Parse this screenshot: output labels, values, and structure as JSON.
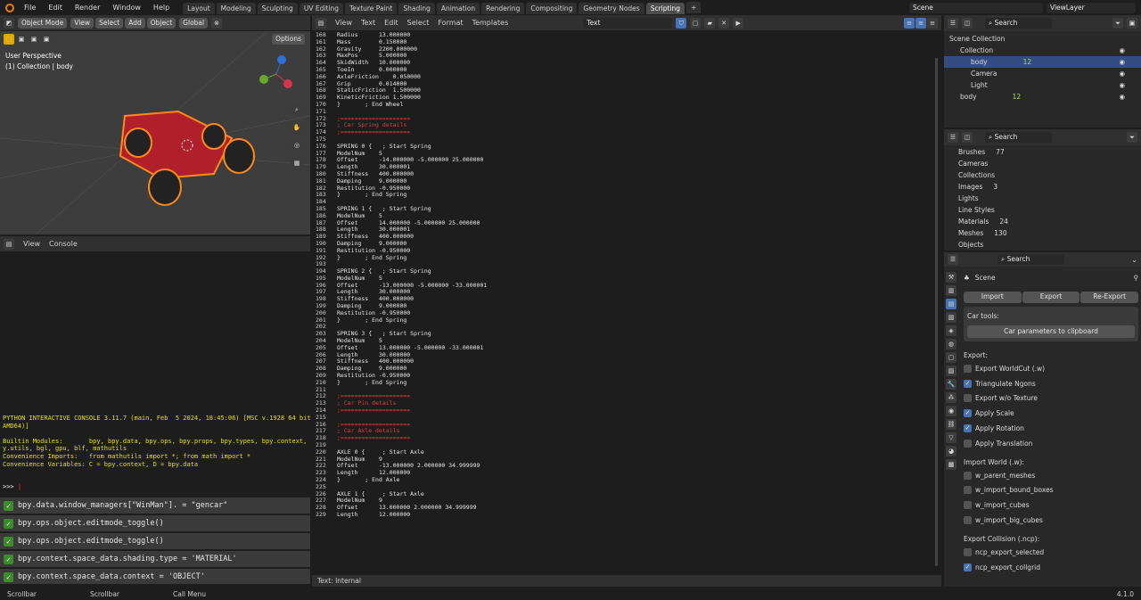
{
  "topbar": {
    "menus": [
      "File",
      "Edit",
      "Render",
      "Window",
      "Help"
    ],
    "tabs": [
      "Layout",
      "Modeling",
      "Sculpting",
      "UV Editing",
      "Texture Paint",
      "Shading",
      "Animation",
      "Rendering",
      "Compositing",
      "Geometry Nodes",
      "Scripting"
    ],
    "active_tab": "Scripting",
    "scene": "Scene",
    "view_layer": "ViewLayer"
  },
  "viewport": {
    "mode": "Object Mode",
    "menus": [
      "View",
      "Select",
      "Add",
      "Object"
    ],
    "transform": "Global",
    "options": "Options",
    "persp": "User Perspective",
    "collection": "(1) Collection | body"
  },
  "console_hdr": {
    "menus": [
      "View",
      "Console"
    ]
  },
  "console": {
    "banner": [
      "PYTHON INTERACTIVE CONSOLE 3.11.7 (main, Feb  5 2024, 18:45:06) [MSC v.1928 64 bit (",
      "AMD64)]",
      "",
      "Builtin Modules:       bpy, bpy.data, bpy.ops, bpy.props, bpy.types, bpy.context, bp",
      "y.utils, bgl, gpu, blf, mathutils",
      "Convenience Imports:   from mathutils import *; from math import *",
      "Convenience Variables: C = bpy.context, D = bpy.data"
    ],
    "prompt": ">>> ",
    "history": [
      "bpy.data.window_managers[\"WinMan\"]. = \"gencar\"",
      "bpy.ops.object.editmode_toggle()",
      "bpy.ops.object.editmode_toggle()",
      "bpy.context.space_data.shading.type = 'MATERIAL'",
      "bpy.context.space_data.context = 'OBJECT'"
    ]
  },
  "text_hdr": {
    "menus": [
      "View",
      "Text",
      "Edit",
      "Select",
      "Format",
      "Templates"
    ],
    "name": "Text"
  },
  "text_footer": "Text: Internal",
  "code": [
    [
      "168",
      "Radius      13.000000"
    ],
    [
      "161",
      "Mass        0.150000"
    ],
    [
      "162",
      "Gravity     2200.000000"
    ],
    [
      "163",
      "MaxPos      5.000000"
    ],
    [
      "164",
      "SkidWidth   10.000000"
    ],
    [
      "165",
      "ToeIn       0.000000"
    ],
    [
      "166",
      "AxleFriction    0.050000"
    ],
    [
      "167",
      "Grip        0.014000"
    ],
    [
      "168",
      "StaticFriction  1.500000"
    ],
    [
      "169",
      "KineticFriction 1.500000"
    ],
    [
      "170",
      "}       ; End Wheel"
    ],
    [
      "171",
      ""
    ],
    [
      "172",
      ";===================="
    ],
    [
      "173",
      "; Car Spring details"
    ],
    [
      "174",
      ";===================="
    ],
    [
      "175",
      ""
    ],
    [
      "176",
      "SPRING 0 {   ; Start Spring"
    ],
    [
      "177",
      "ModelNum    5"
    ],
    [
      "178",
      "Offset      -14.000000 -5.000000 25.000000"
    ],
    [
      "179",
      "Length      30.000001"
    ],
    [
      "180",
      "Stiffness   400.000000"
    ],
    [
      "181",
      "Damping     9.000000"
    ],
    [
      "182",
      "Restitution -0.950000"
    ],
    [
      "183",
      "}       ; End Spring"
    ],
    [
      "184",
      ""
    ],
    [
      "185",
      "SPRING 1 {   ; Start Spring"
    ],
    [
      "186",
      "ModelNum    5"
    ],
    [
      "187",
      "Offset      14.000000 -5.000000 25.000000"
    ],
    [
      "188",
      "Length      30.000001"
    ],
    [
      "189",
      "Stiffness   400.000000"
    ],
    [
      "190",
      "Damping     9.000000"
    ],
    [
      "191",
      "Restitution -0.950000"
    ],
    [
      "192",
      "}       ; End Spring"
    ],
    [
      "193",
      ""
    ],
    [
      "194",
      "SPRING 2 {   ; Start Spring"
    ],
    [
      "195",
      "ModelNum    5"
    ],
    [
      "196",
      "Offset      -13.000000 -5.000000 -33.000001"
    ],
    [
      "197",
      "Length      30.000000"
    ],
    [
      "198",
      "Stiffness   400.000000"
    ],
    [
      "199",
      "Damping     9.000000"
    ],
    [
      "200",
      "Restitution -0.950000"
    ],
    [
      "201",
      "}       ; End Spring"
    ],
    [
      "202",
      ""
    ],
    [
      "203",
      "SPRING 3 {   ; Start Spring"
    ],
    [
      "204",
      "ModelNum    5"
    ],
    [
      "205",
      "Offset      13.000000 -5.000000 -33.000001"
    ],
    [
      "206",
      "Length      30.000000"
    ],
    [
      "207",
      "Stiffness   400.000000"
    ],
    [
      "208",
      "Damping     9.000000"
    ],
    [
      "209",
      "Restitution -0.950000"
    ],
    [
      "210",
      "}       ; End Spring"
    ],
    [
      "211",
      ""
    ],
    [
      "212",
      ";===================="
    ],
    [
      "213",
      "; Car Pin details"
    ],
    [
      "214",
      ";===================="
    ],
    [
      "215",
      ""
    ],
    [
      "216",
      ";===================="
    ],
    [
      "217",
      "; Car Axle details"
    ],
    [
      "218",
      ";===================="
    ],
    [
      "219",
      ""
    ],
    [
      "220",
      "AXLE 0 {     ; Start Axle"
    ],
    [
      "221",
      "ModelNum    9"
    ],
    [
      "222",
      "Offset      -13.000000 2.000000 34.999999"
    ],
    [
      "223",
      "Length      12.000000"
    ],
    [
      "224",
      "}       ; End Axle"
    ],
    [
      "225",
      ""
    ],
    [
      "226",
      "AXLE 1 {     ; Start Axle"
    ],
    [
      "227",
      "ModelNum    9"
    ],
    [
      "228",
      "Offset      13.000000 2.000000 34.999999"
    ],
    [
      "229",
      "Length      12.000000"
    ]
  ],
  "outliner": {
    "search": "Search",
    "items": [
      {
        "label": "Scene Collection",
        "indent": 0
      },
      {
        "label": "Collection",
        "indent": 1
      },
      {
        "label": "body",
        "indent": 2,
        "badge": "12"
      },
      {
        "label": "Camera",
        "indent": 2
      },
      {
        "label": "Light",
        "indent": 2
      },
      {
        "label": "body",
        "indent": 1,
        "badge": "12"
      }
    ]
  },
  "datablocks": {
    "search": "Search",
    "items": [
      {
        "label": "Brushes",
        "badge": "77"
      },
      {
        "label": "Cameras"
      },
      {
        "label": "Collections"
      },
      {
        "label": "Images",
        "badge": "3"
      },
      {
        "label": "Lights"
      },
      {
        "label": "Line Styles"
      },
      {
        "label": "Materials",
        "badge": "24"
      },
      {
        "label": "Meshes",
        "badge": "130"
      },
      {
        "label": "Objects"
      }
    ]
  },
  "props": {
    "search": "Search",
    "scene": "Scene",
    "buttons": [
      "Import",
      "Export",
      "Re-Export"
    ],
    "car_tools": "Car tools:",
    "clipboard": "Car parameters to clipboard",
    "export_label": "Export:",
    "export": [
      {
        "label": "Export WorldCut (.w)",
        "on": false
      },
      {
        "label": "Triangulate Ngons",
        "on": true
      },
      {
        "label": "Export w/o Texture",
        "on": false
      },
      {
        "label": "Apply Scale",
        "on": true
      },
      {
        "label": "Apply Rotation",
        "on": true
      },
      {
        "label": "Apply Translation",
        "on": false
      }
    ],
    "world_label": "Import World (.w):",
    "world": [
      {
        "label": "w_parent_meshes",
        "on": false
      },
      {
        "label": "w_import_bound_boxes",
        "on": false
      },
      {
        "label": "w_import_cubes",
        "on": false
      },
      {
        "label": "w_import_big_cubes",
        "on": false
      }
    ],
    "ncp_label": "Export Collision (.ncp):",
    "ncp": [
      {
        "label": "ncp_export_selected",
        "on": false
      },
      {
        "label": "ncp_export_collgrid",
        "on": true
      }
    ]
  },
  "status": {
    "items": [
      "Scrollbar",
      "Scrollbar",
      "Call Menu"
    ],
    "version": "4.1.0"
  }
}
